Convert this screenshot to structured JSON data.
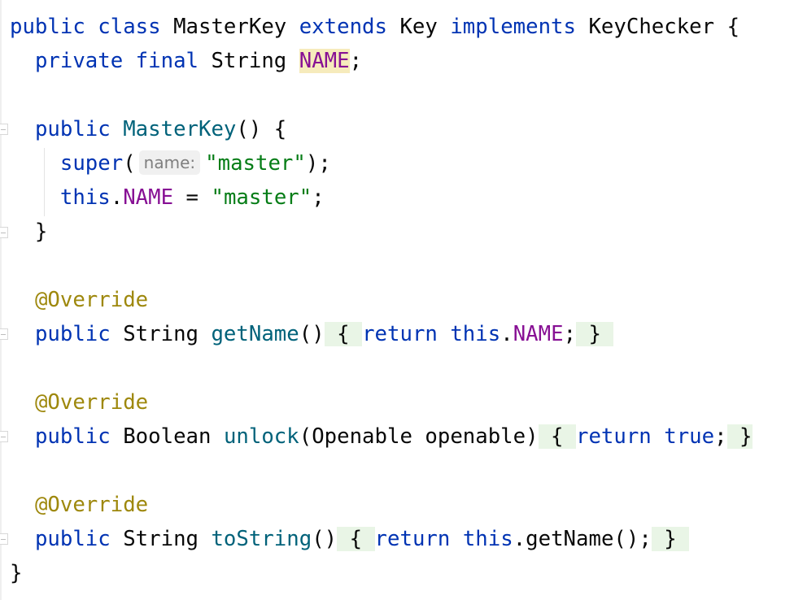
{
  "editor": {
    "lines": [
      {
        "id": "l1",
        "tokens": [
          {
            "t": "public",
            "c": "kw"
          },
          {
            "t": " ",
            "c": "plain"
          },
          {
            "t": "class",
            "c": "kw"
          },
          {
            "t": " ",
            "c": "plain"
          },
          {
            "t": "MasterKey",
            "c": "type"
          },
          {
            "t": " ",
            "c": "plain"
          },
          {
            "t": "extends",
            "c": "kw"
          },
          {
            "t": " ",
            "c": "plain"
          },
          {
            "t": "Key",
            "c": "type"
          },
          {
            "t": " ",
            "c": "plain"
          },
          {
            "t": "implements",
            "c": "kw"
          },
          {
            "t": " ",
            "c": "plain"
          },
          {
            "t": "KeyChecker",
            "c": "type"
          },
          {
            "t": " {",
            "c": "plain"
          }
        ]
      },
      {
        "id": "l2",
        "tokens": [
          {
            "t": "  ",
            "c": "plain"
          },
          {
            "t": "private",
            "c": "kw"
          },
          {
            "t": " ",
            "c": "plain"
          },
          {
            "t": "final",
            "c": "kw"
          },
          {
            "t": " ",
            "c": "plain"
          },
          {
            "t": "String",
            "c": "type"
          },
          {
            "t": " ",
            "c": "plain"
          },
          {
            "t": "NAME",
            "c": "field hl-name"
          },
          {
            "t": ";",
            "c": "plain"
          }
        ]
      },
      {
        "id": "l3",
        "tokens": []
      },
      {
        "id": "l4",
        "tokens": [
          {
            "t": "  ",
            "c": "plain"
          },
          {
            "t": "public",
            "c": "kw"
          },
          {
            "t": " ",
            "c": "plain"
          },
          {
            "t": "MasterKey",
            "c": "fn"
          },
          {
            "t": "() {",
            "c": "plain"
          }
        ]
      },
      {
        "id": "l5",
        "tokens": [
          {
            "t": "    ",
            "c": "plain"
          },
          {
            "t": "super",
            "c": "kw"
          },
          {
            "t": "(",
            "c": "plain"
          },
          {
            "t": "name:",
            "c": "hint"
          },
          {
            "t": "\"master\"",
            "c": "str"
          },
          {
            "t": ");",
            "c": "plain"
          }
        ]
      },
      {
        "id": "l6",
        "tokens": [
          {
            "t": "    ",
            "c": "plain"
          },
          {
            "t": "this",
            "c": "kw"
          },
          {
            "t": ".",
            "c": "plain"
          },
          {
            "t": "NAME",
            "c": "field"
          },
          {
            "t": " = ",
            "c": "plain"
          },
          {
            "t": "\"master\"",
            "c": "str"
          },
          {
            "t": ";",
            "c": "plain"
          }
        ]
      },
      {
        "id": "l7",
        "tokens": [
          {
            "t": "  }",
            "c": "plain"
          }
        ]
      },
      {
        "id": "l8",
        "tokens": []
      },
      {
        "id": "l9",
        "tokens": [
          {
            "t": "  ",
            "c": "plain"
          },
          {
            "t": "@Override",
            "c": "ann"
          }
        ]
      },
      {
        "id": "l10",
        "tokens": [
          {
            "t": "  ",
            "c": "plain"
          },
          {
            "t": "public",
            "c": "kw"
          },
          {
            "t": " ",
            "c": "plain"
          },
          {
            "t": "String",
            "c": "type"
          },
          {
            "t": " ",
            "c": "plain"
          },
          {
            "t": "getName",
            "c": "fn"
          },
          {
            "t": "()",
            "c": "plain"
          },
          {
            "t": " { ",
            "c": "plain fold-bg"
          },
          {
            "t": "return",
            "c": "kw"
          },
          {
            "t": " ",
            "c": "plain"
          },
          {
            "t": "this",
            "c": "kw"
          },
          {
            "t": ".",
            "c": "plain"
          },
          {
            "t": "NAME",
            "c": "field"
          },
          {
            "t": ";",
            "c": "plain"
          },
          {
            "t": " } ",
            "c": "plain fold-bg"
          }
        ]
      },
      {
        "id": "l11",
        "tokens": []
      },
      {
        "id": "l12",
        "tokens": [
          {
            "t": "  ",
            "c": "plain"
          },
          {
            "t": "@Override",
            "c": "ann"
          }
        ]
      },
      {
        "id": "l13",
        "tokens": [
          {
            "t": "  ",
            "c": "plain"
          },
          {
            "t": "public",
            "c": "kw"
          },
          {
            "t": " ",
            "c": "plain"
          },
          {
            "t": "Boolean",
            "c": "type"
          },
          {
            "t": " ",
            "c": "plain"
          },
          {
            "t": "unlock",
            "c": "fn"
          },
          {
            "t": "(Openable openable)",
            "c": "plain"
          },
          {
            "t": " { ",
            "c": "plain fold-bg"
          },
          {
            "t": "return",
            "c": "kw"
          },
          {
            "t": " ",
            "c": "plain"
          },
          {
            "t": "true",
            "c": "kw"
          },
          {
            "t": ";",
            "c": "plain"
          },
          {
            "t": " }",
            "c": "plain fold-bg"
          }
        ]
      },
      {
        "id": "l14",
        "tokens": []
      },
      {
        "id": "l15",
        "tokens": [
          {
            "t": "  ",
            "c": "plain"
          },
          {
            "t": "@Override",
            "c": "ann"
          }
        ]
      },
      {
        "id": "l16",
        "tokens": [
          {
            "t": "  ",
            "c": "plain"
          },
          {
            "t": "public",
            "c": "kw"
          },
          {
            "t": " ",
            "c": "plain"
          },
          {
            "t": "String",
            "c": "type"
          },
          {
            "t": " ",
            "c": "plain"
          },
          {
            "t": "toString",
            "c": "fn"
          },
          {
            "t": "()",
            "c": "plain"
          },
          {
            "t": " { ",
            "c": "plain fold-bg"
          },
          {
            "t": "return",
            "c": "kw"
          },
          {
            "t": " ",
            "c": "plain"
          },
          {
            "t": "this",
            "c": "kw"
          },
          {
            "t": ".getName();",
            "c": "plain"
          },
          {
            "t": " } ",
            "c": "plain fold-bg"
          }
        ]
      },
      {
        "id": "l17",
        "tokens": [
          {
            "t": "}",
            "c": "plain"
          }
        ]
      }
    ],
    "colors": {
      "keyword": "#0033b3",
      "function": "#00627a",
      "field": "#871094",
      "string": "#067d17",
      "annotation": "#9e880d",
      "name_highlight": "#f6ebbc",
      "folded_region": "#e9f5e6"
    }
  }
}
